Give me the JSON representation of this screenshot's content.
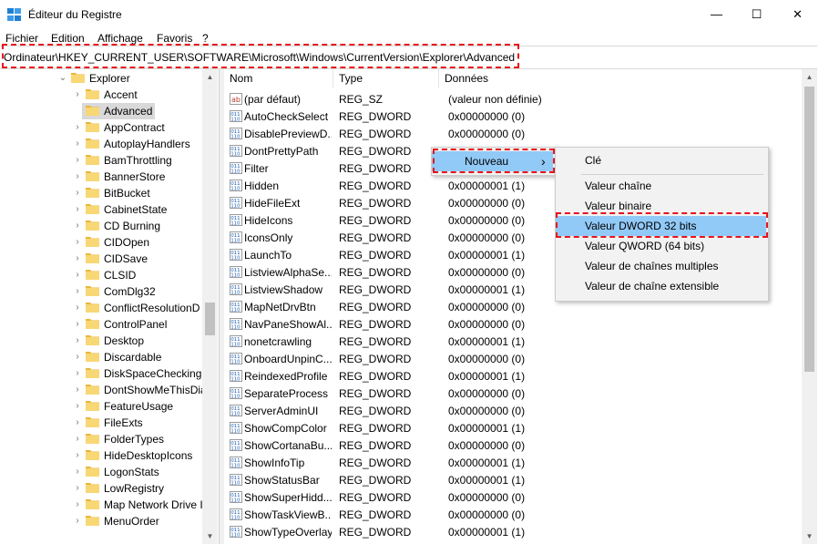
{
  "window": {
    "title": "Éditeur du Registre",
    "minimize": "—",
    "maximize": "☐",
    "close": "✕"
  },
  "menu": [
    "Fichier",
    "Edition",
    "Affichage",
    "Favoris",
    "?"
  ],
  "address": "Ordinateur\\HKEY_CURRENT_USER\\SOFTWARE\\Microsoft\\Windows\\CurrentVersion\\Explorer\\Advanced",
  "tree": [
    {
      "label": "Explorer",
      "expanded": true
    },
    {
      "label": "Accent"
    },
    {
      "label": "Advanced",
      "selected": true
    },
    {
      "label": "AppContract"
    },
    {
      "label": "AutoplayHandlers"
    },
    {
      "label": "BamThrottling"
    },
    {
      "label": "BannerStore"
    },
    {
      "label": "BitBucket"
    },
    {
      "label": "CabinetState"
    },
    {
      "label": "CD Burning"
    },
    {
      "label": "CIDOpen"
    },
    {
      "label": "CIDSave"
    },
    {
      "label": "CLSID"
    },
    {
      "label": "ComDlg32"
    },
    {
      "label": "ConflictResolutionD"
    },
    {
      "label": "ControlPanel"
    },
    {
      "label": "Desktop"
    },
    {
      "label": "Discardable"
    },
    {
      "label": "DiskSpaceChecking"
    },
    {
      "label": "DontShowMeThisDia"
    },
    {
      "label": "FeatureUsage"
    },
    {
      "label": "FileExts"
    },
    {
      "label": "FolderTypes"
    },
    {
      "label": "HideDesktopIcons"
    },
    {
      "label": "LogonStats"
    },
    {
      "label": "LowRegistry"
    },
    {
      "label": "Map Network Drive I"
    },
    {
      "label": "MenuOrder"
    }
  ],
  "columns": {
    "name": "Nom",
    "type": "Type",
    "data": "Données"
  },
  "values": [
    {
      "name": "(par défaut)",
      "type": "REG_SZ",
      "data": "(valeur non définie)",
      "kind": "sz"
    },
    {
      "name": "AutoCheckSelect",
      "type": "REG_DWORD",
      "data": "0x00000000 (0)"
    },
    {
      "name": "DisablePreviewD...",
      "type": "REG_DWORD",
      "data": "0x00000000 (0)"
    },
    {
      "name": "DontPrettyPath",
      "type": "REG_DWORD",
      "data": ""
    },
    {
      "name": "Filter",
      "type": "REG_DWORD",
      "data": ""
    },
    {
      "name": "Hidden",
      "type": "REG_DWORD",
      "data": "0x00000001 (1)"
    },
    {
      "name": "HideFileExt",
      "type": "REG_DWORD",
      "data": "0x00000000 (0)"
    },
    {
      "name": "HideIcons",
      "type": "REG_DWORD",
      "data": "0x00000000 (0)"
    },
    {
      "name": "IconsOnly",
      "type": "REG_DWORD",
      "data": "0x00000000 (0)"
    },
    {
      "name": "LaunchTo",
      "type": "REG_DWORD",
      "data": "0x00000001 (1)"
    },
    {
      "name": "ListviewAlphaSe...",
      "type": "REG_DWORD",
      "data": "0x00000000 (0)"
    },
    {
      "name": "ListviewShadow",
      "type": "REG_DWORD",
      "data": "0x00000001 (1)"
    },
    {
      "name": "MapNetDrvBtn",
      "type": "REG_DWORD",
      "data": "0x00000000 (0)"
    },
    {
      "name": "NavPaneShowAl...",
      "type": "REG_DWORD",
      "data": "0x00000000 (0)"
    },
    {
      "name": "nonetcrawling",
      "type": "REG_DWORD",
      "data": "0x00000001 (1)"
    },
    {
      "name": "OnboardUnpinC...",
      "type": "REG_DWORD",
      "data": "0x00000000 (0)"
    },
    {
      "name": "ReindexedProfile",
      "type": "REG_DWORD",
      "data": "0x00000001 (1)"
    },
    {
      "name": "SeparateProcess",
      "type": "REG_DWORD",
      "data": "0x00000000 (0)"
    },
    {
      "name": "ServerAdminUI",
      "type": "REG_DWORD",
      "data": "0x00000000 (0)"
    },
    {
      "name": "ShowCompColor",
      "type": "REG_DWORD",
      "data": "0x00000001 (1)"
    },
    {
      "name": "ShowCortanaBu...",
      "type": "REG_DWORD",
      "data": "0x00000000 (0)"
    },
    {
      "name": "ShowInfoTip",
      "type": "REG_DWORD",
      "data": "0x00000001 (1)"
    },
    {
      "name": "ShowStatusBar",
      "type": "REG_DWORD",
      "data": "0x00000001 (1)"
    },
    {
      "name": "ShowSuperHidd...",
      "type": "REG_DWORD",
      "data": "0x00000000 (0)"
    },
    {
      "name": "ShowTaskViewB...",
      "type": "REG_DWORD",
      "data": "0x00000000 (0)"
    },
    {
      "name": "ShowTypeOverlay",
      "type": "REG_DWORD",
      "data": "0x00000001 (1)"
    }
  ],
  "context_menu": {
    "item": "Nouveau",
    "arrow": "›"
  },
  "submenu": {
    "top": "Clé",
    "items": [
      "Valeur chaîne",
      "Valeur binaire",
      "Valeur DWORD 32 bits",
      "Valeur QWORD (64 bits)",
      "Valeur de chaînes multiples",
      "Valeur de chaîne extensible"
    ],
    "highlighted_index": 2
  },
  "colors": {
    "annotation": "#e8141b",
    "menu_highlight": "#91c9f7",
    "tree_selection": "#d9d9d9",
    "folder": "#f8d775"
  }
}
